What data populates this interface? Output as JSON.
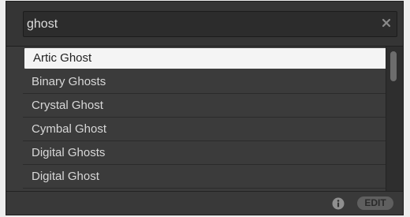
{
  "search": {
    "value": "ghost",
    "clear_icon": "close-icon"
  },
  "results": {
    "selected_index": 0,
    "items": [
      {
        "label": "Artic Ghost"
      },
      {
        "label": "Binary Ghosts"
      },
      {
        "label": "Crystal Ghost"
      },
      {
        "label": "Cymbal Ghost"
      },
      {
        "label": "Digital Ghosts"
      },
      {
        "label": "Digital Ghost"
      }
    ]
  },
  "footer": {
    "info_icon": "info-icon",
    "edit_label": "EDIT"
  },
  "colors": {
    "panel_bg": "#303030",
    "list_bg": "#3b3b3b",
    "selection_bg": "#f4f4f4",
    "text": "#d8d8d8"
  }
}
